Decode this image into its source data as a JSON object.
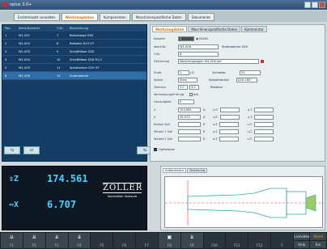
{
  "window": {
    "title": "nplus 3.0+"
  },
  "main_tabs": [
    {
      "label": "Eratzteilwatt verwalten"
    },
    {
      "label": "Werkzeugdaten"
    },
    {
      "label": "Komponenten"
    },
    {
      "label": "Maschinenspezifische Daten"
    },
    {
      "label": "Dokumente"
    }
  ],
  "left_table": {
    "headers": [
      "Pos.",
      "Ident-Nummer",
      "T-Nr.",
      "Bezeichnung"
    ],
    "rows": [
      {
        "pos": "1",
        "id": "W1-001",
        "t": "7",
        "desc": "Bohrstange D50"
      },
      {
        "pos": "2",
        "id": "W1-002",
        "t": "8",
        "desc": "Reibahle D19 H7"
      },
      {
        "pos": "3",
        "id": "W1-003",
        "t": "9",
        "desc": "Schaftfräser D20"
      },
      {
        "pos": "4",
        "id": "W1-004",
        "t": "10",
        "desc": "Schaftfräser D16 R1.0"
      },
      {
        "pos": "5",
        "id": "W1-005",
        "t": "11",
        "desc": "Spiralbohrer D19 H7"
      },
      {
        "pos": "6",
        "id": "W1-006",
        "t": "12",
        "desc": "Stufenbohrer"
      }
    ]
  },
  "right_tabs": [
    {
      "label": "Werkzeugdaten"
    },
    {
      "label": "Maschinenspezifische Daten"
    },
    {
      "label": "Kommentar"
    }
  ],
  "form": {
    "adapter_label": "Adapter",
    "adapter_value": "2",
    "adapter_extra": "ISO40",
    "ident_label": "Ident-Nr.",
    "ident_value": "W1-006",
    "ident_desc": "Stufenbohrer D19",
    "tnr_label": "T-Nr.",
    "tnr_value": "6",
    "zeichnung_label": "Zeichnung",
    "zeichnung_value": "Werkzeugwagen W1-006.dxf",
    "stufe_label": "Stufe",
    "stufe_value": "1",
    "stufe_of": "(1)",
    "schneide_label": "Schneide",
    "schneide_value": "01",
    "spitze_label": "Spitze",
    "spitze_value": "Stein",
    "spitzenwinkel_label": "Spitzenwinkel",
    "spitzenwinkel_value": "D16 160°",
    "toleranz_label": "Toleranz",
    "toleranz_a": "3.0",
    "toleranz_b": "3.0",
    "rotation_label": "Rotation",
    "checkbox_label": "mit",
    "genauigkeit_label": "Genauigkeit",
    "genauigkeit_value": "0",
    "vermessung_label": "Vermessung/Prüfung",
    "z_label": "Z",
    "z_value": "103.681",
    "x_label": "X",
    "x_value": "39.973",
    "radius_label": "Radius Soll",
    "w1_label": "Winkel 1 Soll",
    "w2_label": "Winkel 2 Soll",
    "a_abbr": "A",
    "e_abbr": "E",
    "o_abbr": "o.T.",
    "u_abbr": "u.T.",
    "optimieren_label": "Optimieren"
  },
  "display": {
    "z_axis": "Z",
    "z_value": "174.561",
    "x_axis": "X",
    "x_value": "6.707",
    "brand": "ZOLLER",
    "slogan": "fascination measure"
  },
  "preview_tabs": [
    {
      "label": "Außenkontur"
    },
    {
      "label": "Zeichnung"
    }
  ],
  "fkeys": [
    {
      "label": "F1"
    },
    {
      "label": "F2"
    },
    {
      "label": "F3"
    },
    {
      "label": "F4"
    },
    {
      "label": "F5"
    },
    {
      "label": "F6"
    },
    {
      "label": "F7"
    },
    {
      "label": "F8"
    },
    {
      "label": "F9"
    },
    {
      "label": "F10"
    },
    {
      "label": "F11"
    },
    {
      "label": "F12"
    },
    {
      "label": "F"
    }
  ],
  "side_buttons": {
    "livevideo": "Livevideo",
    "alarm": "Alarm",
    "help": "Help",
    "esc": "Esc"
  },
  "colors": {
    "accent": "#e07000",
    "table_bg": "#143c64",
    "readout": "#42d4ff"
  }
}
